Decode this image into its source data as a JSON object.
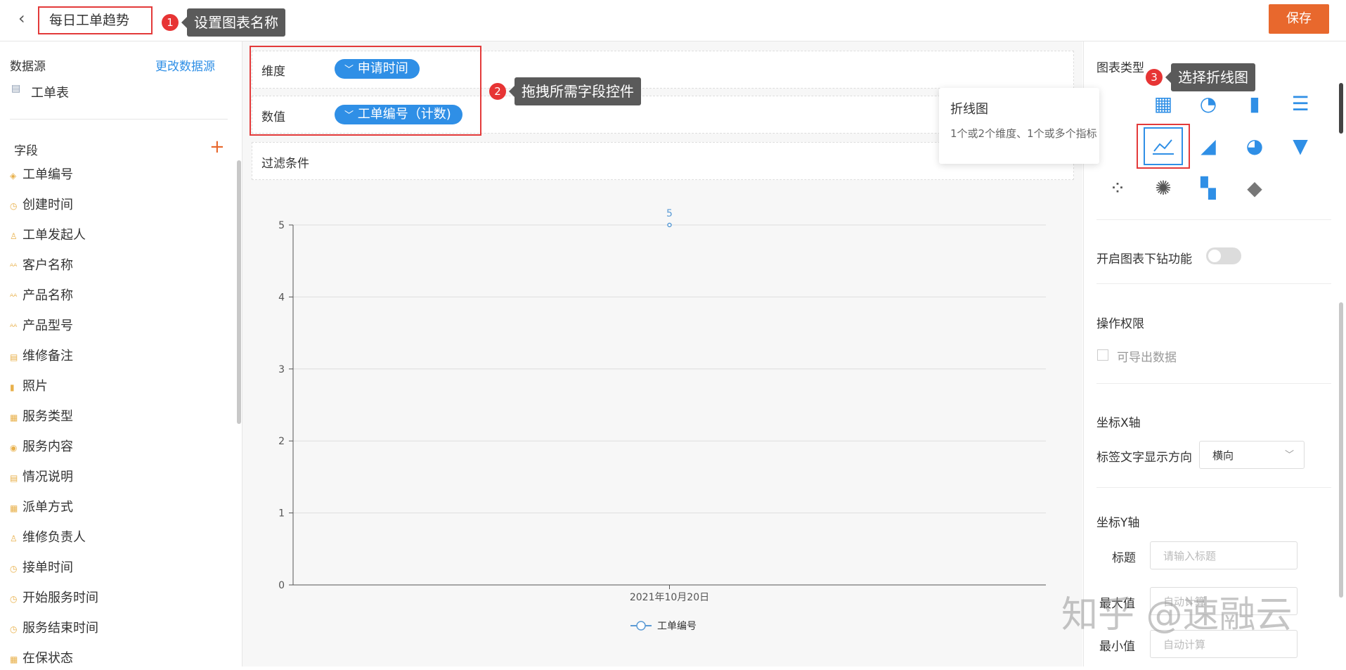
{
  "header": {
    "back_glyph": "‹",
    "chart_name": "每日工单趋势",
    "save_label": "保存"
  },
  "annotations": [
    {
      "num": "1",
      "text": "设置图表名称"
    },
    {
      "num": "2",
      "text": "拖拽所需字段控件"
    },
    {
      "num": "3",
      "text": "选择折线图"
    }
  ],
  "left": {
    "datasource_label": "数据源",
    "change_datasource": "更改数据源",
    "table_name": "工单表",
    "fields_label": "字段",
    "add_glyph": "+",
    "fields": [
      {
        "label": "工单编号",
        "icon": "serial-icon"
      },
      {
        "label": "创建时间",
        "icon": "clock-icon"
      },
      {
        "label": "工单发起人",
        "icon": "user-icon"
      },
      {
        "label": "客户名称",
        "icon": "text-icon"
      },
      {
        "label": "产品名称",
        "icon": "text-icon"
      },
      {
        "label": "产品型号",
        "icon": "text-icon"
      },
      {
        "label": "维修备注",
        "icon": "textarea-icon"
      },
      {
        "label": "照片",
        "icon": "file-icon"
      },
      {
        "label": "服务类型",
        "icon": "select-icon"
      },
      {
        "label": "服务内容",
        "icon": "radio-icon"
      },
      {
        "label": "情况说明",
        "icon": "textarea-icon"
      },
      {
        "label": "派单方式",
        "icon": "select-icon"
      },
      {
        "label": "维修负责人",
        "icon": "user-icon"
      },
      {
        "label": "接单时间",
        "icon": "clock-icon"
      },
      {
        "label": "开始服务时间",
        "icon": "clock-icon"
      },
      {
        "label": "服务结束时间",
        "icon": "clock-icon"
      },
      {
        "label": "在保状态",
        "icon": "select-icon"
      }
    ]
  },
  "config": {
    "dimension_label": "维度",
    "dimension_value": "申请时间",
    "measure_label": "数值",
    "measure_value": "工单编号（计数)",
    "filter_label": "过滤条件"
  },
  "chart_data": {
    "type": "line",
    "categories": [
      "2021年10月20日"
    ],
    "series": [
      {
        "name": "工单编号",
        "values": [
          5
        ]
      }
    ],
    "ylim": [
      0,
      5
    ],
    "yticks": [
      "0",
      "1",
      "2",
      "3",
      "4",
      "5"
    ],
    "data_labels": [
      "5"
    ],
    "grid": true,
    "legend": "bottom-center"
  },
  "right": {
    "chart_type_label": "图表类型",
    "chart_icons": [
      "table-icon",
      "gauge-icon",
      "bar-chart-icon",
      "horizontal-bar-icon",
      "line-chart-icon",
      "area-chart-icon",
      "pie-chart-icon",
      "funnel-icon",
      "scatter-icon",
      "radar-icon",
      "treemap-icon",
      "map-icon"
    ],
    "popover_title": "折线图",
    "popover_desc": "1个或2个维度、1个或多个指标",
    "drilldown_label": "开启图表下钻功能",
    "permission_label": "操作权限",
    "export_label": "可导出数据",
    "xaxis_label": "坐标X轴",
    "label_direction_label": "标签文字显示方向",
    "label_direction_value": "横向",
    "yaxis_label": "坐标Y轴",
    "y_title_label": "标题",
    "y_title_placeholder": "请输入标题",
    "y_max_label": "最大值",
    "y_max_placeholder": "自动计算",
    "y_min_label": "最小值",
    "y_min_placeholder": "自动计算",
    "watermark": "知乎 @速融云",
    "accent_color": "#2f8fe6",
    "save_color": "#e8682d"
  }
}
